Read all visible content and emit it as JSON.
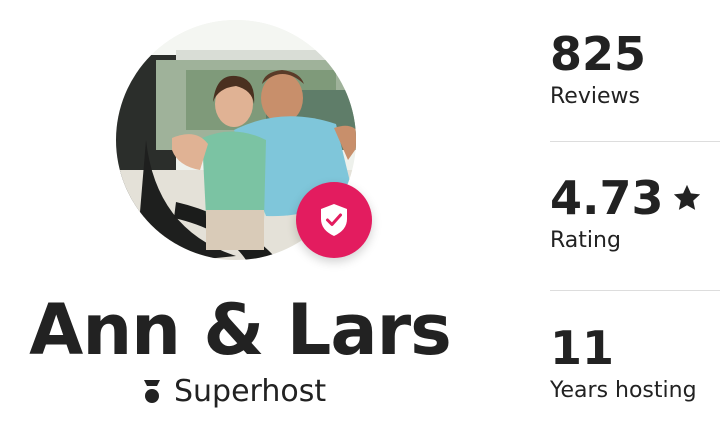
{
  "host": {
    "name": "Ann & Lars",
    "badge_label": "Superhost",
    "avatar_icon": "host-photo",
    "verified_icon": "shield-check-icon",
    "superhost_icon": "superhost-medal-icon",
    "accent_color": "#e31c5f"
  },
  "stats": [
    {
      "value": "825",
      "label": "Reviews"
    },
    {
      "value": "4.73",
      "label": "Rating",
      "icon": "star-icon"
    },
    {
      "value": "11",
      "label": "Years hosting"
    }
  ]
}
